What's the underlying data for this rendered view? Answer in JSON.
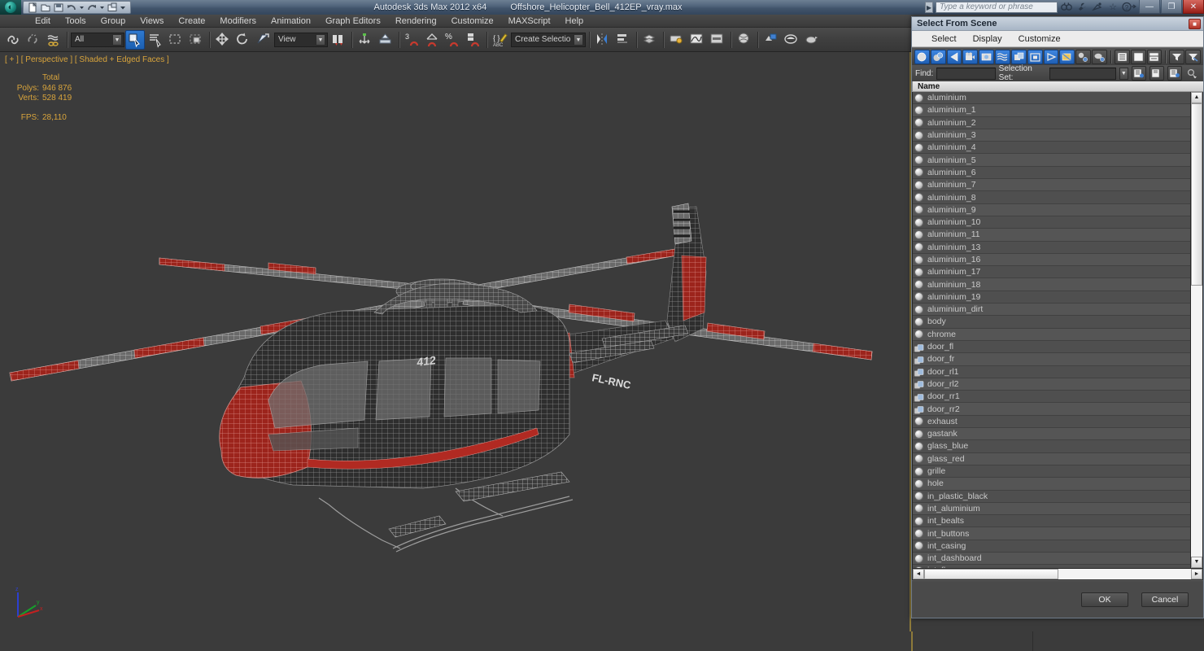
{
  "app": {
    "title": "Autodesk 3ds Max  2012 x64",
    "filename": "Offshore_Helicopter_Bell_412EP_vray.max",
    "orb_glyph": "◔",
    "quick_access": [
      {
        "name": "new-file-icon",
        "glyph": "὜B"
      },
      {
        "name": "open-file-icon",
        "glyph": "὜1"
      },
      {
        "name": "save-file-icon",
        "glyph": "ὋE"
      },
      {
        "name": "undo-icon",
        "glyph": "↶"
      },
      {
        "name": "redo-icon",
        "glyph": "↷"
      },
      {
        "name": "set-project-folder-icon",
        "glyph": "὜2"
      },
      {
        "name": "qat-dropdown-icon",
        "glyph": "▾"
      }
    ],
    "search": {
      "placeholder": "Type a keyword or phrase",
      "icons": [
        "binoculars-icon",
        "wrench-icon",
        "satellite-icon",
        "star-icon",
        "help-icon"
      ]
    },
    "window_buttons": [
      {
        "name": "minimize-button",
        "glyph": "—"
      },
      {
        "name": "restore-button",
        "glyph": "❐"
      },
      {
        "name": "close-button",
        "glyph": "✕"
      }
    ]
  },
  "menu": {
    "items": [
      "Edit",
      "Tools",
      "Group",
      "Views",
      "Create",
      "Modifiers",
      "Animation",
      "Graph Editors",
      "Rendering",
      "Customize",
      "MAXScript",
      "Help"
    ]
  },
  "toolbar": {
    "selection_filter": "All",
    "reference_coord": "View",
    "named_selection_set": "Create Selection Se",
    "angle_snap_value": "3",
    "groups": [
      [
        "undo-icon",
        "redo-icon"
      ],
      [
        "select-link-icon",
        "unlink-icon",
        "bind-to-space-warp-icon"
      ],
      [
        "selection-filter-combo",
        "select-object-icon",
        "select-by-name-icon",
        "rectangular-selection-region-icon",
        "window-crossing-icon"
      ],
      [
        "select-and-move-icon",
        "select-and-rotate-icon",
        "select-and-scale-icon",
        "reference-coordinate-combo"
      ],
      [
        "use-pivot-center-icon",
        "select-and-manipulate-icon",
        "snaps-toggle-icon"
      ],
      [
        "angle-snap-toggle-icon",
        "percent-snap-toggle-icon",
        "spinner-snap-toggle-icon"
      ],
      [
        "edit-named-selection-sets-icon",
        "named-selection-set-combo"
      ],
      [
        "mirror-icon",
        "align-icon",
        "layer-manager-icon"
      ],
      [
        "graphite-modeling-tools-icon",
        "curve-editor-icon",
        "schematic-view-icon"
      ],
      [
        "material-editor-icon",
        "render-setup-icon",
        "rendered-frame-window-icon",
        "render-production-icon"
      ]
    ]
  },
  "viewport": {
    "label": "[ + ] [ Perspective ] [ Shaded + Edged Faces ]",
    "stats": {
      "column_header": "Total",
      "polys_label": "Polys:",
      "polys_value": "946 876",
      "verts_label": "Verts:",
      "verts_value": "528 419",
      "fps_label": "FPS:",
      "fps_value": "28,110"
    },
    "scene": {
      "model": "Bell 412EP Offshore Helicopter",
      "registration": "FL-RNC",
      "fuselage_number": "412",
      "colors": {
        "background": "#3b3b3b",
        "wire_grey": "#9a9a9a",
        "wire_red": "#b12a22",
        "stat_text": "#d8a43c"
      }
    },
    "axis_tripod": {
      "x": "x",
      "y": "y",
      "z": "z"
    }
  },
  "dialog": {
    "title": "Select From Scene",
    "close_glyph": "■",
    "menu": [
      "Select",
      "Display",
      "Customize"
    ],
    "toolbar_buttons": [
      {
        "name": "display-geometry-icon",
        "active": true
      },
      {
        "name": "display-shapes-icon",
        "active": true
      },
      {
        "name": "display-lights-icon",
        "active": true
      },
      {
        "name": "display-cameras-icon",
        "active": true
      },
      {
        "name": "display-helpers-icon",
        "active": true
      },
      {
        "name": "display-space-warps-icon",
        "active": true
      },
      {
        "name": "display-groups-icon",
        "active": true
      },
      {
        "name": "display-xrefs-icon",
        "active": true
      },
      {
        "name": "display-bone-objects-icon",
        "active": true
      },
      {
        "name": "display-all-none-icon",
        "active": true
      },
      {
        "name": "display-children-icon",
        "active": false
      },
      {
        "name": "display-influences-icon",
        "active": false
      },
      {
        "name": "expand-all-icon",
        "active": false
      },
      {
        "name": "collapse-all-icon",
        "active": false
      },
      {
        "name": "list-types-icon",
        "active": false
      },
      {
        "name": "filter-icon",
        "active": false
      },
      {
        "name": "clear-filter-icon",
        "active": false
      }
    ],
    "find_label": "Find:",
    "find_value": "",
    "selection_set_label": "Selection Set:",
    "selection_set_value": "",
    "set_buttons": [
      "add-selection-set-icon",
      "remove-selection-set-icon",
      "edit-selection-set-icon",
      "more-options-icon"
    ],
    "column_header": "Name",
    "items": [
      {
        "name": "aluminium",
        "icon": "sphere"
      },
      {
        "name": "aluminium_1",
        "icon": "sphere"
      },
      {
        "name": "aluminium_2",
        "icon": "sphere"
      },
      {
        "name": "aluminium_3",
        "icon": "sphere"
      },
      {
        "name": "aluminium_4",
        "icon": "sphere"
      },
      {
        "name": "aluminium_5",
        "icon": "sphere"
      },
      {
        "name": "aluminium_6",
        "icon": "sphere"
      },
      {
        "name": "aluminium_7",
        "icon": "sphere"
      },
      {
        "name": "aluminium_8",
        "icon": "sphere"
      },
      {
        "name": "aluminium_9",
        "icon": "sphere"
      },
      {
        "name": "aluminium_10",
        "icon": "sphere"
      },
      {
        "name": "aluminium_11",
        "icon": "sphere"
      },
      {
        "name": "aluminium_13",
        "icon": "sphere"
      },
      {
        "name": "aluminium_16",
        "icon": "sphere"
      },
      {
        "name": "aluminium_17",
        "icon": "sphere"
      },
      {
        "name": "aluminium_18",
        "icon": "sphere"
      },
      {
        "name": "aluminium_19",
        "icon": "sphere"
      },
      {
        "name": "aluminium_dirt",
        "icon": "sphere"
      },
      {
        "name": "body",
        "icon": "sphere"
      },
      {
        "name": "chrome",
        "icon": "sphere"
      },
      {
        "name": "door_fl",
        "icon": "group"
      },
      {
        "name": "door_fr",
        "icon": "group"
      },
      {
        "name": "door_rl1",
        "icon": "group"
      },
      {
        "name": "door_rl2",
        "icon": "group"
      },
      {
        "name": "door_rr1",
        "icon": "group"
      },
      {
        "name": "door_rr2",
        "icon": "group"
      },
      {
        "name": "exhaust",
        "icon": "sphere"
      },
      {
        "name": "gastank",
        "icon": "sphere"
      },
      {
        "name": "glass_blue",
        "icon": "sphere"
      },
      {
        "name": "glass_red",
        "icon": "sphere"
      },
      {
        "name": "grille",
        "icon": "sphere"
      },
      {
        "name": "hole",
        "icon": "sphere"
      },
      {
        "name": "in_plastic_black",
        "icon": "sphere"
      },
      {
        "name": "int_aluminium",
        "icon": "sphere"
      },
      {
        "name": "int_bealts",
        "icon": "sphere"
      },
      {
        "name": "int_buttons",
        "icon": "sphere"
      },
      {
        "name": "int_casing",
        "icon": "sphere"
      },
      {
        "name": "int_dashboard",
        "icon": "sphere"
      },
      {
        "name": "int_floor",
        "icon": "sphere"
      }
    ],
    "buttons": {
      "ok": "OK",
      "cancel": "Cancel"
    },
    "scrollbars": {
      "vertical_up": "▲",
      "vertical_down": "▼",
      "horizontal_left": "◄",
      "horizontal_right": "►"
    }
  }
}
